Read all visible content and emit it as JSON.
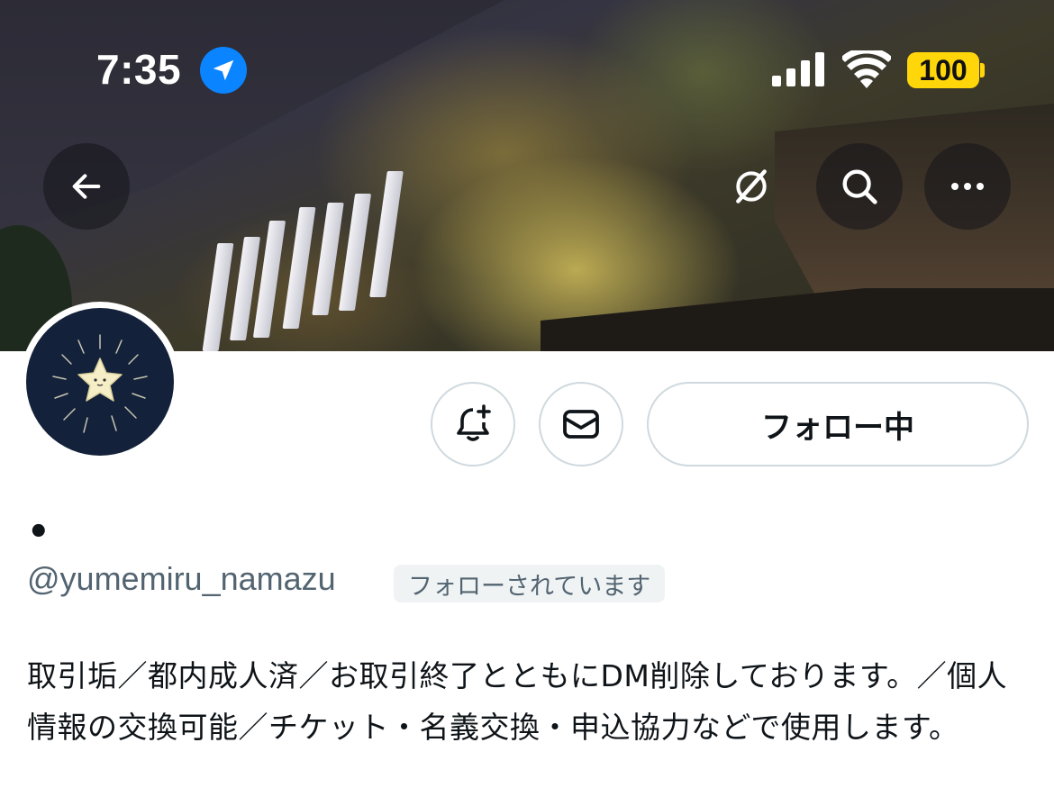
{
  "status_bar": {
    "time": "7:35",
    "battery": "100",
    "icons": [
      "location-arrow-icon",
      "cellular-signal-icon",
      "wifi-icon",
      "battery-icon"
    ],
    "colors": {
      "location": "#0a84ff",
      "battery": "#ffd60a"
    }
  },
  "header": {
    "buttons": [
      "back-arrow-icon",
      "grok-icon",
      "search-icon",
      "more-horizontal-icon"
    ]
  },
  "profile": {
    "display_name": "•",
    "handle": "@yumemiru_namazu",
    "follows_you_badge": "フォローされています",
    "bio": "取引垢／都内成人済／お取引終了とともにDM削除しております。／個人情報の交換可能／チケット・名義交換・申込協力などで使用します。"
  },
  "actions": {
    "follow_button": "フォロー中",
    "icons": [
      "bell-plus-icon",
      "mail-icon"
    ]
  }
}
